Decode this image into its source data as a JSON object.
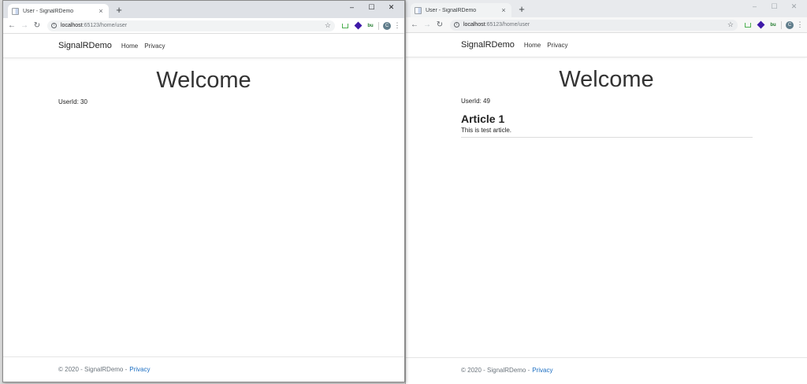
{
  "left": {
    "tab_title": "User - SignalRDemo",
    "url_host": "localhost",
    "url_path": ":65123/home/user",
    "brand": "SignalRDemo",
    "nav_home": "Home",
    "nav_privacy": "Privacy",
    "heading": "Welcome",
    "userid": "UserId: 30",
    "footer_text": "© 2020 - SignalRDemo -",
    "footer_link": "Privacy"
  },
  "right": {
    "tab_title": "User - SignalRDemo",
    "url_host": "localhost",
    "url_path": ":65123/home/user",
    "brand": "SignalRDemo",
    "nav_home": "Home",
    "nav_privacy": "Privacy",
    "heading": "Welcome",
    "userid": "UserId: 49",
    "article_title": "Article 1",
    "article_body": "This is test article.",
    "footer_text": "© 2020 - SignalRDemo -",
    "footer_link": "Privacy"
  },
  "browser": {
    "new_tab_glyph": "+",
    "tab_close_glyph": "×",
    "minimize_glyph": "–",
    "maximize_glyph": "☐",
    "close_glyph": "✕",
    "back_glyph": "←",
    "forward_glyph": "→",
    "reload_glyph": "↻",
    "star_glyph": "☆",
    "menu_glyph": "⋮",
    "avatar_letter": "C",
    "ext_bu": "bu",
    "info_glyph": "i"
  }
}
